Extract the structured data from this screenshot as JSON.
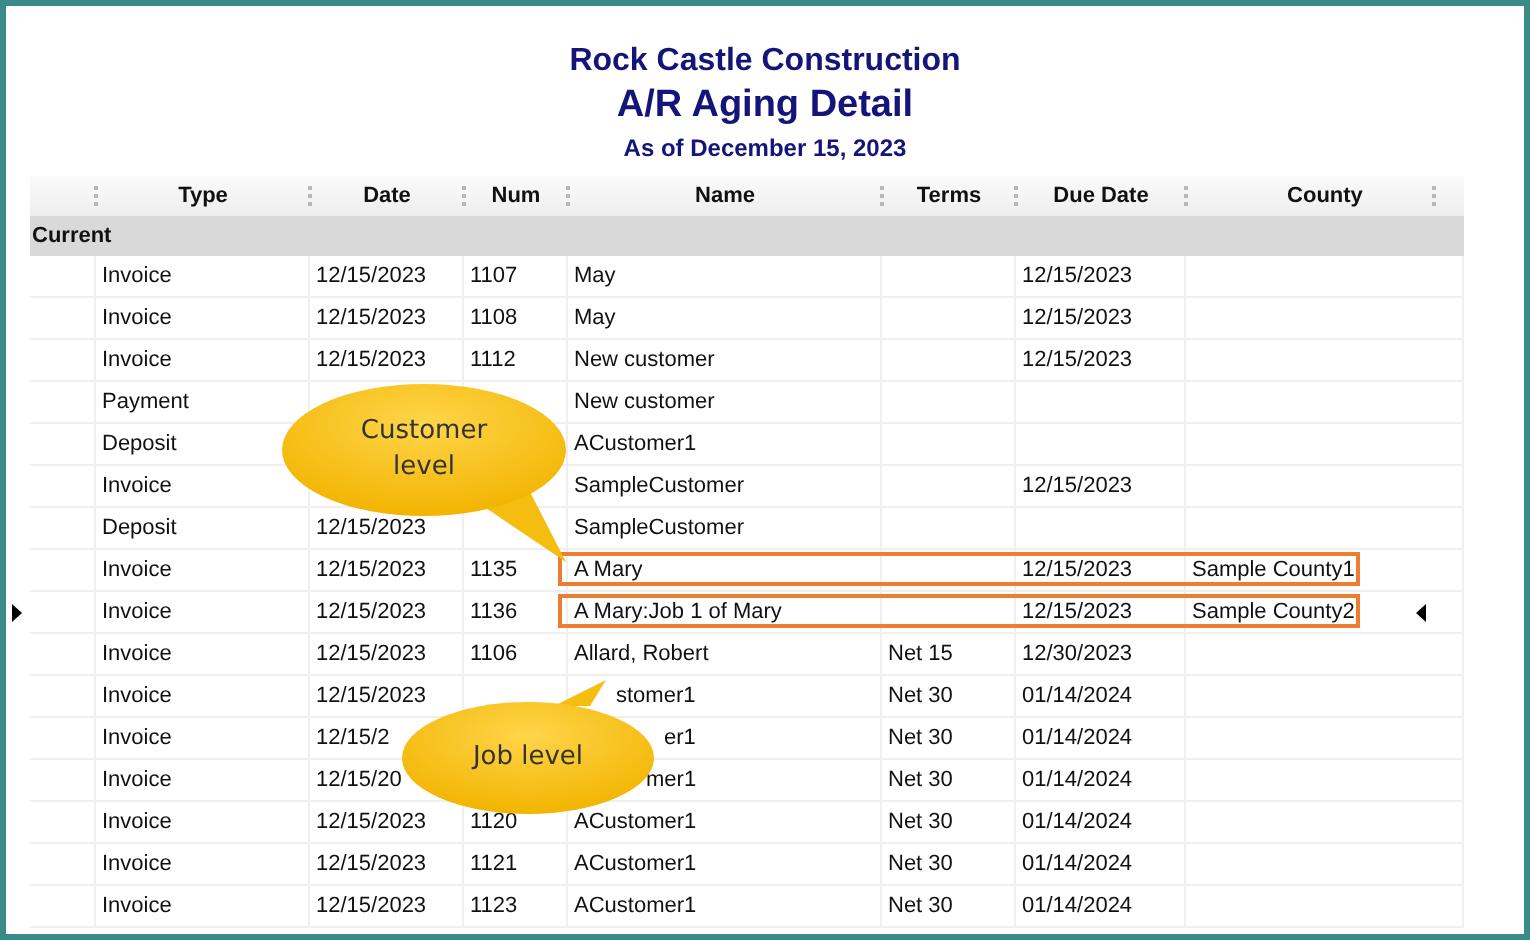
{
  "report": {
    "company": "Rock Castle Construction",
    "title": "A/R Aging Detail",
    "subtitle": "As of December 15, 2023"
  },
  "columns": [
    "Type",
    "Date",
    "Num",
    "Name",
    "Terms",
    "Due Date",
    "County"
  ],
  "section": "Current",
  "rows": [
    {
      "type": "Invoice",
      "date": "12/15/2023",
      "num": "1107",
      "name": "May",
      "due_date": "12/15/2023",
      "highlighted": false,
      "current": false
    },
    {
      "type": "Invoice",
      "date": "12/15/2023",
      "num": "1108",
      "name": "May",
      "due_date": "12/15/2023",
      "highlighted": false,
      "current": false
    },
    {
      "type": "Invoice",
      "date": "12/15/2023",
      "num": "1112",
      "name": "New customer",
      "due_date": "12/15/2023",
      "highlighted": false,
      "current": false
    },
    {
      "type": "Payment",
      "name": "New customer",
      "highlighted": false,
      "current": false
    },
    {
      "type": "Deposit",
      "name": "ACustomer1",
      "highlighted": false,
      "current": false
    },
    {
      "type": "Invoice",
      "name": "SampleCustomer",
      "due_date": "12/15/2023",
      "highlighted": false,
      "current": false
    },
    {
      "type": "Deposit",
      "date": "12/15/2023",
      "name": "SampleCustomer",
      "highlighted": false,
      "current": false
    },
    {
      "type": "Invoice",
      "date": "12/15/2023",
      "num": "1135",
      "name": "A Mary",
      "due_date": "12/15/2023",
      "county": "Sample County1",
      "highlighted": true,
      "current": false
    },
    {
      "type": "Invoice",
      "date": "12/15/2023",
      "num": "1136",
      "name": "A Mary:Job 1 of Mary",
      "due_date": "12/15/2023",
      "county": "Sample County2",
      "highlighted": true,
      "current": true
    },
    {
      "type": "Invoice",
      "date": "12/15/2023",
      "num": "1106",
      "name": "Allard, Robert",
      "terms": "Net 15",
      "due_date": "12/30/2023",
      "highlighted": false,
      "current": false
    },
    {
      "type": "Invoice",
      "date": "12/15/2023",
      "name": "stomer1",
      "terms": "Net 30",
      "due_date": "01/14/2024",
      "highlighted": false,
      "current": false
    },
    {
      "type": "Invoice",
      "date": "12/15/2",
      "name": "er1",
      "terms": "Net 30",
      "due_date": "01/14/2024",
      "highlighted": false,
      "current": false
    },
    {
      "type": "Invoice",
      "date": "12/15/20",
      "name": "mer1",
      "terms": "Net 30",
      "due_date": "01/14/2024",
      "highlighted": false,
      "current": false
    },
    {
      "type": "Invoice",
      "date": "12/15/2023",
      "num": "1120",
      "name": "ACustomer1",
      "terms": "Net 30",
      "due_date": "01/14/2024",
      "highlighted": false,
      "current": false
    },
    {
      "type": "Invoice",
      "date": "12/15/2023",
      "num": "1121",
      "name": "ACustomer1",
      "terms": "Net 30",
      "due_date": "01/14/2024",
      "highlighted": false,
      "current": false
    },
    {
      "type": "Invoice",
      "date": "12/15/2023",
      "num": "1123",
      "name": "ACustomer1",
      "terms": "Net 30",
      "due_date": "01/14/2024",
      "highlighted": false,
      "current": false
    }
  ],
  "callouts": [
    {
      "text": "Customer level"
    },
    {
      "text": "Job level"
    }
  ]
}
